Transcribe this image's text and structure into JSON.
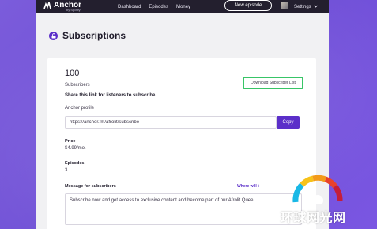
{
  "nav": {
    "brand": "Anchor",
    "brand_sub": "by Spotify",
    "links": [
      "Dashboard",
      "Episodes",
      "Money"
    ],
    "new_episode": "New episode",
    "settings": "Settings"
  },
  "page": {
    "title": "Subscriptions"
  },
  "card": {
    "count": "100",
    "count_label": "Subscribers",
    "download_button": "Download Subscriber List",
    "share_heading": "Share this link for listeners to subscribe",
    "profile_label": "Anchor profile",
    "link_value": "https://anchor.fm/afrolit/subscribe",
    "copy_button": "Copy",
    "price_label": "Price",
    "price_value": "$4.99/mo.",
    "episodes_label": "Episodes",
    "episodes_value": "3",
    "message_label": "Message for subscribers",
    "where_link": "Where will t",
    "message_value": "Subscribe now and get access to exclusive content and become part of our Afrolit Quee"
  },
  "watermark": {
    "text": "环球网光网"
  },
  "colors": {
    "accent": "#5b2fc9",
    "highlight": "#38c567",
    "nav_bg": "#231f2e"
  }
}
